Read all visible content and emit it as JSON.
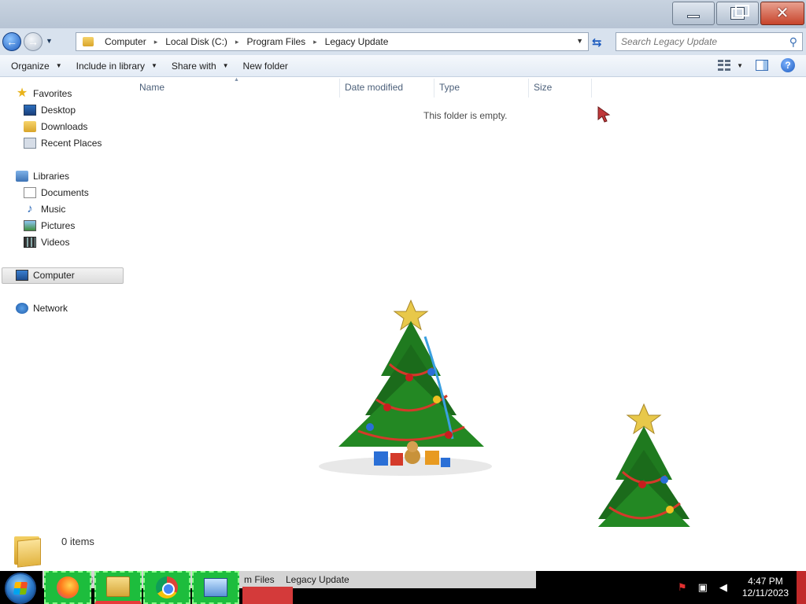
{
  "window": {
    "minimize_label": "Minimize",
    "restore_label": "Restore",
    "close_label": "Close"
  },
  "address": {
    "crumbs": [
      "Computer",
      "Local Disk (C:)",
      "Program Files",
      "Legacy Update"
    ]
  },
  "search": {
    "placeholder": "Search Legacy Update"
  },
  "toolbar": {
    "organize": "Organize",
    "include_in_library": "Include in library",
    "share_with": "Share with",
    "new_folder": "New folder"
  },
  "nav": {
    "favorites": "Favorites",
    "desktop": "Desktop",
    "downloads": "Downloads",
    "recent_places": "Recent Places",
    "libraries": "Libraries",
    "documents": "Documents",
    "music": "Music",
    "pictures": "Pictures",
    "videos": "Videos",
    "computer": "Computer",
    "network": "Network"
  },
  "columns": {
    "name": "Name",
    "date_modified": "Date modified",
    "type": "Type",
    "size": "Size"
  },
  "content": {
    "empty_message": "This folder is empty."
  },
  "details": {
    "item_count": "0 items"
  },
  "taskbar": {
    "search_ghost": "Search Legacy Update",
    "ghost_crumb_1": "m Files",
    "ghost_crumb_2": "Legacy Update",
    "time": "4:47 PM",
    "date": "12/11/2023"
  }
}
